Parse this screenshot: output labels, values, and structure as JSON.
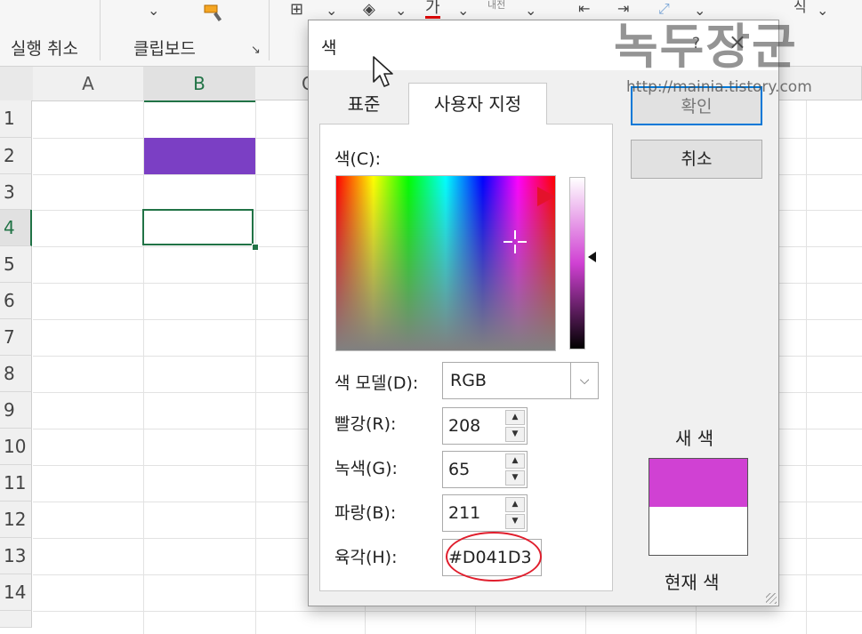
{
  "ribbon": {
    "undo_group_label": "실행 취소",
    "clipboard_group_label": "클립보드",
    "text_color_glyph": "가",
    "font_group_partial": "내전",
    "right_partial": "식"
  },
  "sheet": {
    "columns": [
      "A",
      "B",
      "C"
    ],
    "rows": [
      "1",
      "2",
      "3",
      "4",
      "5",
      "6",
      "7",
      "8",
      "9",
      "10",
      "11",
      "12",
      "13",
      "14"
    ],
    "filled_cell_color": "#7b3fc4"
  },
  "dialog": {
    "title": "색",
    "help": "?",
    "close": "×",
    "tabs": [
      "표준",
      "사용자 지정"
    ],
    "active_tab": "사용자 지정",
    "color_label": "색(C):",
    "color_model_label": "색 모델(D):",
    "color_model_value": "RGB",
    "red_label": "빨강(R):",
    "red_value": "208",
    "green_label": "녹색(G):",
    "green_value": "65",
    "blue_label": "파랑(B):",
    "blue_value": "211",
    "hex_label": "육각(H):",
    "hex_value": "#D041D3",
    "ok_label": "확인",
    "cancel_label": "취소",
    "new_color_label": "새 색",
    "current_color_label": "현재 색",
    "new_color": "#D041D3",
    "current_color": "#FFFFFF"
  },
  "watermark": {
    "title": "녹두장군",
    "url": "http://mainia.tistory.com"
  }
}
